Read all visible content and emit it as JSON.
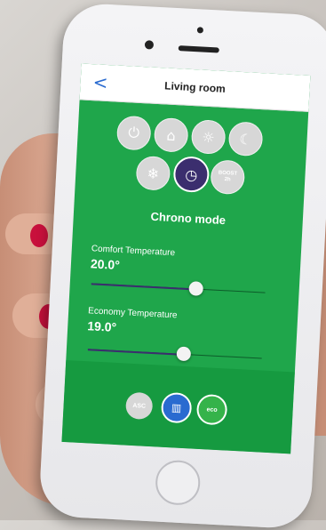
{
  "header": {
    "back_label": "<",
    "title": "Living room"
  },
  "modes": [
    {
      "name": "power",
      "icon": "power-icon",
      "glyph": "⏻"
    },
    {
      "name": "home",
      "icon": "home-icon",
      "glyph": "⌂"
    },
    {
      "name": "comfort",
      "icon": "sun-icon",
      "glyph": "☼"
    },
    {
      "name": "night",
      "icon": "moon-icon",
      "glyph": "☾"
    },
    {
      "name": "frost",
      "icon": "snowflake-icon",
      "glyph": "❄"
    },
    {
      "name": "chrono",
      "icon": "clock-icon",
      "glyph": "◷",
      "active": true
    },
    {
      "name": "boost",
      "icon": "boost-icon",
      "label": "BOOST\n2h"
    }
  ],
  "mode_title": "Chrono mode",
  "comfort": {
    "label": "Comfort Temperature",
    "value": "20.0°",
    "level": 0.6
  },
  "economy": {
    "label": "Economy Temperature",
    "value": "19.0°",
    "level": 0.55
  },
  "bottom": {
    "asc_label": "ASC",
    "window_icon": "window-icon",
    "eco_label": "eco"
  },
  "colors": {
    "screen_green": "#1fa64b",
    "accent_purple": "#3b2e6e",
    "nav_blue": "#2a6bd0"
  }
}
